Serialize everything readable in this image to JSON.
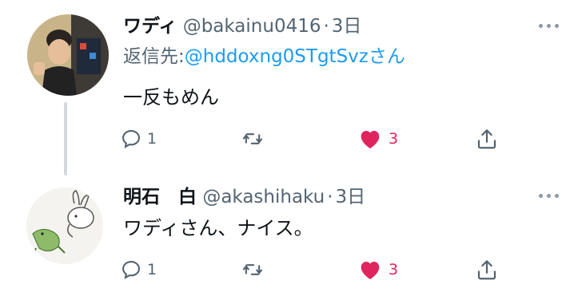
{
  "tweets": [
    {
      "name": "ワディ",
      "handle": "@bakainu0416",
      "separator": "·",
      "time": "3日",
      "reply_label": "返信先:",
      "reply_handle": "@hddoxng0STgtSvz",
      "reply_suffix": "さん",
      "text": "一反もめん",
      "replies": "1",
      "likes": "3"
    },
    {
      "name": "明石　白",
      "handle": "@akashihaku",
      "separator": "·",
      "time": "3日",
      "text": "ワディさん、ナイス。",
      "replies": "1",
      "likes": "3"
    }
  ],
  "colors": {
    "link": "#1d9bf0",
    "like": "#e0245e",
    "secondary": "#536471"
  },
  "icons": [
    "reply-icon",
    "retweet-icon",
    "like-icon",
    "share-icon",
    "more-icon"
  ]
}
